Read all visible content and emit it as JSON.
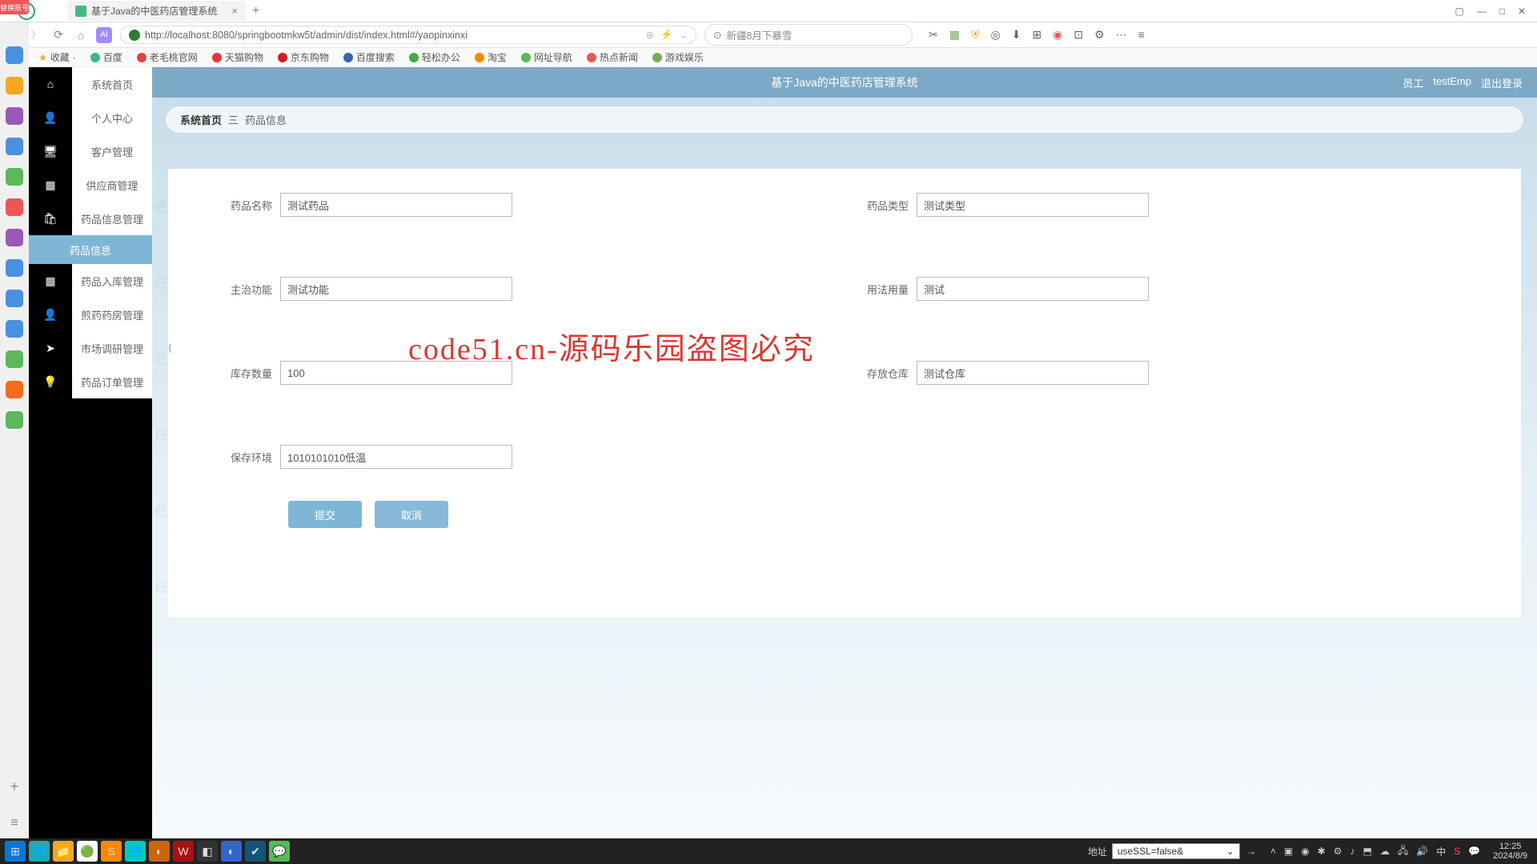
{
  "browser": {
    "tab_title": "基于Java的中医药店管理系统",
    "url": "http://localhost:8080/springbootmkw5t/admin/dist/index.html#/yaopinxinxi",
    "search_placeholder": "新疆8月下暴雪"
  },
  "bookmarks": {
    "fav_label": "收藏",
    "items": [
      "百度",
      "老毛桃官网",
      "天猫购物",
      "京东购物",
      "百度搜索",
      "轻松办公",
      "淘宝",
      "网址导航",
      "热点新闻",
      "游戏娱乐"
    ]
  },
  "sidebar": {
    "items": [
      {
        "label": "系统首页",
        "icon": "home"
      },
      {
        "label": "个人中心",
        "icon": "user"
      },
      {
        "label": "客户管理",
        "icon": "desktop"
      },
      {
        "label": "供应商管理",
        "icon": "grid"
      },
      {
        "label": "药品信息管理",
        "icon": "bag"
      }
    ],
    "sub_item": "药品信息",
    "items2": [
      {
        "label": "药品入库管理",
        "icon": "grid"
      },
      {
        "label": "煎药药房管理",
        "icon": "user"
      },
      {
        "label": "市场调研管理",
        "icon": "send"
      },
      {
        "label": "药品订单管理",
        "icon": "bulb"
      }
    ]
  },
  "header": {
    "title": "基于Java的中医药店管理系统",
    "user_role": "员工",
    "user_name": "testEmp",
    "logout": "退出登录"
  },
  "breadcrumb": {
    "home": "系统首页",
    "sep": "三",
    "current": "药品信息"
  },
  "form": {
    "labels": {
      "name": "药品名称",
      "type": "药品类型",
      "func": "主治功能",
      "usage": "用法用量",
      "stock": "库存数量",
      "warehouse": "存放仓库",
      "env": "保存环境"
    },
    "values": {
      "name": "测试药品",
      "type": "测试类型",
      "func": "测试功能",
      "usage": "测试",
      "stock": "100",
      "warehouse": "测试仓库",
      "env": "1010101010低温"
    },
    "submit": "提交",
    "cancel": "取消"
  },
  "watermark": "code51.cn",
  "watermark_red": "code51.cn-源码乐园盗图必究",
  "taskbar": {
    "addr_label": "地址",
    "addr_value": "useSSL=false&",
    "time": "12:25",
    "date": "2024/8/9"
  },
  "os_badge": "替换账号"
}
